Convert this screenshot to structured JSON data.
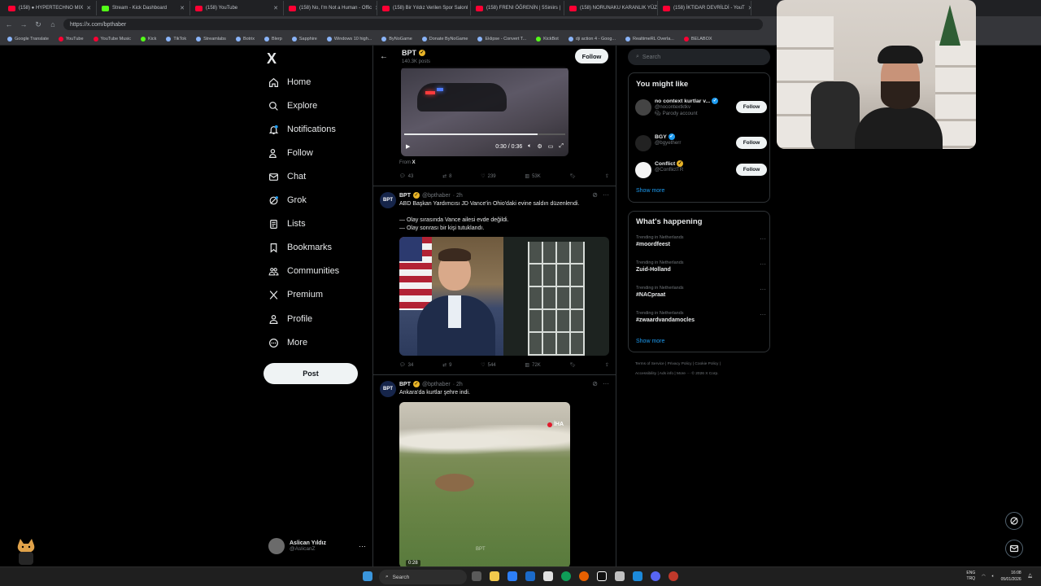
{
  "browser": {
    "tabs": [
      {
        "label": "(158) ● HYPERTECHNO MIX"
      },
      {
        "label": "Stream - Kick Dashboard"
      },
      {
        "label": "(158) YouTube"
      },
      {
        "label": "(158) No, I'm Not a Human - Offic"
      },
      {
        "label": "(158) Bir Yıldız Verilen Spor Salonl"
      },
      {
        "label": "(158) FRENI ÖĞRENİN | 5Siniirs |"
      },
      {
        "label": "(158) NORUNAKU KARANLIK YÜZ"
      },
      {
        "label": "(158) İKTIDAR DEVRİLDİ - YouT"
      }
    ],
    "url": "https://x.com/bpthaber",
    "bookmarks": [
      {
        "label": "Google Translate"
      },
      {
        "label": "YouTube"
      },
      {
        "label": "YouTube Music"
      },
      {
        "label": "Kick"
      },
      {
        "label": "TikTok"
      },
      {
        "label": "Streamlabs"
      },
      {
        "label": "Botrix"
      },
      {
        "label": "Blerp"
      },
      {
        "label": "Sapphire"
      },
      {
        "label": "Windows 10 high..."
      },
      {
        "label": "ByNoGame"
      },
      {
        "label": "Donate ByNoGame"
      },
      {
        "label": "Eklipse - Convert T..."
      },
      {
        "label": "KickBot"
      },
      {
        "label": "dji action 4 - Goog..."
      },
      {
        "label": "RealtimeRL Overla..."
      },
      {
        "label": "BELABOX"
      }
    ]
  },
  "nav": {
    "logo": "X",
    "items": [
      {
        "label": "Home"
      },
      {
        "label": "Explore"
      },
      {
        "label": "Notifications"
      },
      {
        "label": "Follow"
      },
      {
        "label": "Chat"
      },
      {
        "label": "Grok"
      },
      {
        "label": "Lists"
      },
      {
        "label": "Bookmarks"
      },
      {
        "label": "Communities"
      },
      {
        "label": "Premium"
      },
      {
        "label": "Profile"
      },
      {
        "label": "More"
      }
    ],
    "post_label": "Post",
    "account": {
      "name": "Aslican Yıldız",
      "handle": "@AslicanZ"
    }
  },
  "profile_header": {
    "name": "BPT",
    "posts": "140.3K posts",
    "follow_label": "Follow"
  },
  "tweet1": {
    "video_time": "0:30 / 0:36",
    "progress": 0.83,
    "from_prefix": "From",
    "from_source": "X",
    "stats": {
      "replies": "43",
      "reposts": "8",
      "likes": "239",
      "views": "53K"
    }
  },
  "tweet2": {
    "name": "BPT",
    "handle": "@bpthaber",
    "time": "· 2h",
    "text_line1": "ABD Başkan Yardımcısı JD Vance'in Ohio'daki evine saldırı düzenlendi.",
    "text_line2": "— Olay sırasında Vance ailesi evde değildi.",
    "text_line3": "— Olay sonrası bir kişi tutuklandı.",
    "stats": {
      "replies": "34",
      "reposts": "9",
      "likes": "544",
      "views": "72K"
    }
  },
  "tweet3": {
    "name": "BPT",
    "handle": "@bpthaber",
    "time": "· 2h",
    "text": "Ankara'da kurtlar şehre indi.",
    "watermark": "İHA",
    "video_watermark": "BPT",
    "video_time": "0:28"
  },
  "right": {
    "search_placeholder": "Search",
    "might_like_title": "You might like",
    "suggestions": [
      {
        "name": "no context kurtlar v...",
        "handle": "@nocontextktkv",
        "note": "Parody account",
        "follow": "Follow"
      },
      {
        "name": "BGY",
        "handle": "@bgyetherr",
        "note": "",
        "follow": "Follow"
      },
      {
        "name": "Conflict",
        "handle": "@ConflictTR",
        "note": "",
        "follow": "Follow"
      }
    ],
    "show_more": "Show more",
    "happening_title": "What's happening",
    "trends": [
      {
        "context": "Trending in Netherlands",
        "name": "#moordfeest"
      },
      {
        "context": "Trending in Netherlands",
        "name": "Zuid-Holland"
      },
      {
        "context": "Trending in Netherlands",
        "name": "#NACpraat"
      },
      {
        "context": "Trending in Netherlands",
        "name": "#zwaardvandamocles"
      }
    ],
    "show_more2": "Show more",
    "footer_line1": "Terms of Service  |  Privacy Policy  |  Cookie Policy  |",
    "footer_line2": "Accessibility  |  Ads info  |  More ···  © 2026 X Corp."
  },
  "taskbar": {
    "search_placeholder": "Search",
    "lang_top": "ENG",
    "lang_bottom": "TRQ",
    "time": "16:08",
    "date": "05/01/2026"
  },
  "colors": {
    "accent": "#1d9bf0",
    "verified_gold": "#e9b428",
    "background": "#000000"
  }
}
